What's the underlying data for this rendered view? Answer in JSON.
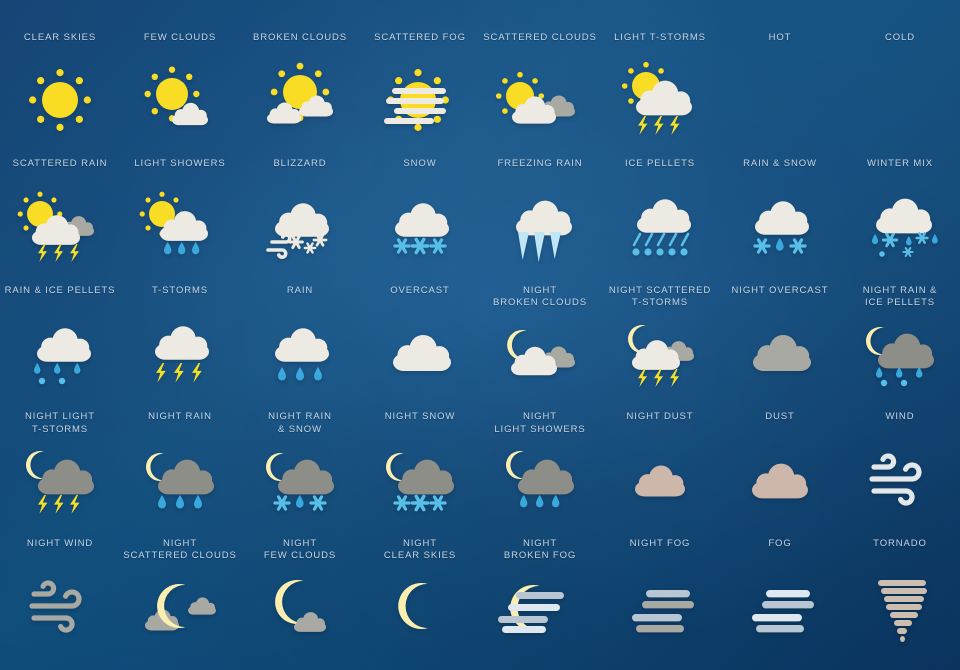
{
  "sheet": {
    "title": "Weather Icons Set",
    "background_top": "#0d3f72",
    "background_mid": "#105182",
    "background_bottom": "#0a3764",
    "label_color": "#c6d6e6",
    "columns": 8,
    "rows": 5
  },
  "palette": {
    "sun_yellow": "#f9dc24",
    "moon_cream": "#faefb0",
    "cloud_white": "#eceae3",
    "cloud_light": "#e4e2db",
    "cloud_grey": "#a9a9a3",
    "cloud_dark_grey": "#9b9b94",
    "night_cloud_grey": "#8e8e88",
    "dust_tan": "#cdb7ab",
    "fog_blue_grey": "#b8c6d4",
    "fog_white": "#dfe8f0",
    "rain_blue": "#3aa8dd",
    "snow_blue": "#57bfe8",
    "ice_blue": "#bfe6f7",
    "lightning_yellow": "#f5e028",
    "thermo_red": "#e02b28",
    "thermo_blue": "#3aa8dd",
    "thermo_case": "#c9cdd2",
    "tornado_tan": "#cdbdae",
    "wind_white": "#e3e7ea"
  },
  "icons": [
    {
      "label": "CLEAR SKIES",
      "name": "clear-skies",
      "glyph": "sun"
    },
    {
      "label": "FEW CLOUDS",
      "name": "few-clouds",
      "glyph": "sun-cloud-small"
    },
    {
      "label": "BROKEN CLOUDS",
      "name": "broken-clouds",
      "glyph": "sun-cloud-large"
    },
    {
      "label": "SCATTERED FOG",
      "name": "scattered-fog",
      "glyph": "sun-fog"
    },
    {
      "label": "SCATTERED CLOUDS",
      "name": "scattered-clouds",
      "glyph": "sun-two-clouds"
    },
    {
      "label": "LIGHT T-STORMS",
      "name": "light-t-storms",
      "glyph": "sun-cloud-lightning"
    },
    {
      "label": "HOT",
      "name": "hot",
      "glyph": "thermometer-hot"
    },
    {
      "label": "COLD",
      "name": "cold",
      "glyph": "thermometer-cold"
    },
    {
      "label": "SCATTERED RAIN",
      "name": "scattered-rain",
      "glyph": "sun-two-clouds-lightning"
    },
    {
      "label": "LIGHT SHOWERS",
      "name": "light-showers",
      "glyph": "sun-cloud-rain"
    },
    {
      "label": "BLIZZARD",
      "name": "blizzard",
      "glyph": "cloud-wind-snow"
    },
    {
      "label": "SNOW",
      "name": "snow",
      "glyph": "cloud-snow"
    },
    {
      "label": "FREEZING RAIN",
      "name": "freezing-rain",
      "glyph": "cloud-icicles"
    },
    {
      "label": "ICE PELLETS",
      "name": "ice-pellets",
      "glyph": "cloud-pellets"
    },
    {
      "label": "RAIN & SNOW",
      "name": "rain-and-snow",
      "glyph": "cloud-rain-snow"
    },
    {
      "label": "WINTER MIX",
      "name": "winter-mix",
      "glyph": "cloud-winter-mix"
    },
    {
      "label": "RAIN & ICE PELLETS",
      "name": "rain-and-ice-pellets",
      "glyph": "cloud-rain-pellets"
    },
    {
      "label": "T-STORMS",
      "name": "t-storms",
      "glyph": "cloud-lightning"
    },
    {
      "label": "RAIN",
      "name": "rain",
      "glyph": "cloud-rain"
    },
    {
      "label": "OVERCAST",
      "name": "overcast",
      "glyph": "cloud-plain"
    },
    {
      "label": "NIGHT\nBROKEN CLOUDS",
      "name": "night-broken-clouds",
      "glyph": "moon-two-clouds"
    },
    {
      "label": "NIGHT SCATTERED\nT-STORMS",
      "name": "night-scattered-t-storms",
      "glyph": "moon-two-clouds-lightning"
    },
    {
      "label": "NIGHT OVERCAST",
      "name": "night-overcast",
      "glyph": "cloud-grey-plain"
    },
    {
      "label": "NIGHT RAIN &\nICE PELLETS",
      "name": "night-rain-and-ice-pellets",
      "glyph": "moon-cloud-rain-pellets"
    },
    {
      "label": "NIGHT LIGHT\nT-STORMS",
      "name": "night-light-t-storms",
      "glyph": "moon-greycloud-lightning"
    },
    {
      "label": "NIGHT RAIN",
      "name": "night-rain",
      "glyph": "moon-greycloud-rain"
    },
    {
      "label": "NIGHT RAIN\n& SNOW",
      "name": "night-rain-and-snow",
      "glyph": "moon-greycloud-rain-snow"
    },
    {
      "label": "NIGHT SNOW",
      "name": "night-snow",
      "glyph": "moon-greycloud-snow"
    },
    {
      "label": "NIGHT\nLIGHT SHOWERS",
      "name": "night-light-showers",
      "glyph": "moon-greycloud-showers"
    },
    {
      "label": "NIGHT DUST",
      "name": "night-dust",
      "glyph": "dust-cloud-small"
    },
    {
      "label": "DUST",
      "name": "dust",
      "glyph": "dust-cloud-large"
    },
    {
      "label": "WIND",
      "name": "wind",
      "glyph": "wind"
    },
    {
      "label": "NIGHT WIND",
      "name": "night-wind",
      "glyph": "wind-grey"
    },
    {
      "label": "NIGHT\nSCATTERED CLOUDS",
      "name": "night-scattered-clouds",
      "glyph": "moon-scattered-clouds"
    },
    {
      "label": "NIGHT\nFEW CLOUDS",
      "name": "night-few-clouds",
      "glyph": "moon-few-clouds"
    },
    {
      "label": "NIGHT\nCLEAR SKIES",
      "name": "night-clear-skies",
      "glyph": "moon"
    },
    {
      "label": "NIGHT\nBROKEN FOG",
      "name": "night-broken-fog",
      "glyph": "moon-fog"
    },
    {
      "label": "NIGHT FOG",
      "name": "night-fog",
      "glyph": "fog-grey"
    },
    {
      "label": "FOG",
      "name": "fog",
      "glyph": "fog-white"
    },
    {
      "label": "TORNADO",
      "name": "tornado",
      "glyph": "tornado"
    }
  ]
}
